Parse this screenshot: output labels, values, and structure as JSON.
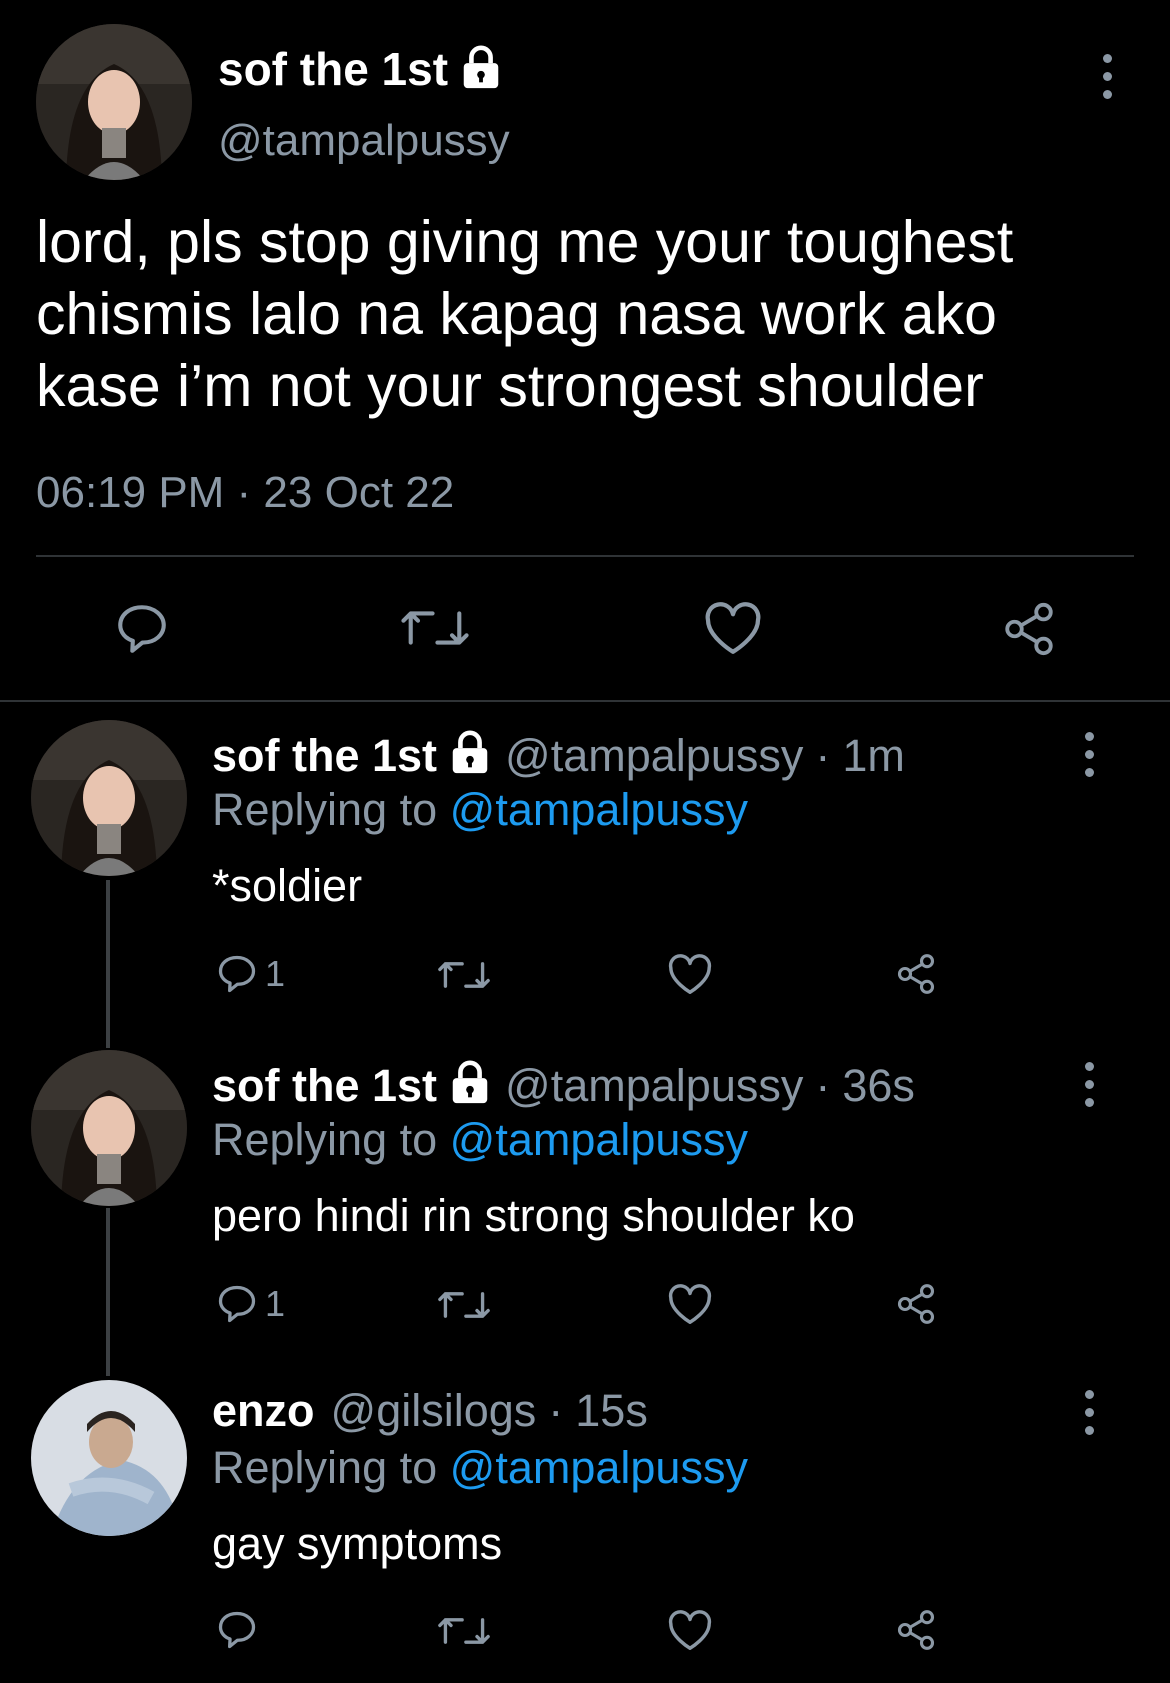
{
  "main_tweet": {
    "display_name": "sof the 1st",
    "handle": "@tampalpussy",
    "text_lines": [
      "lord, pls stop giving me your toughest",
      "chismis lalo na kapag nasa work ako",
      "kase i’m not your strongest shoulder"
    ],
    "timestamp": "06:19 PM · 23 Oct 22",
    "actions": [
      "reply-icon",
      "retweet-icon",
      "like-icon",
      "share-icon"
    ]
  },
  "replies": [
    {
      "display_name": "sof the 1st",
      "handle": "@tampalpussy",
      "sep": "·",
      "time": "1m",
      "replying_label": "Replying to",
      "replying_handle": "@tampalpussy",
      "text": "*soldier",
      "reply_count": "1"
    },
    {
      "display_name": "sof the 1st",
      "handle": "@tampalpussy",
      "sep": "·",
      "time": "36s",
      "replying_label": "Replying to",
      "replying_handle": "@tampalpussy",
      "text": "pero hindi rin strong shoulder ko",
      "reply_count": "1"
    },
    {
      "display_name": "enzo",
      "handle": "@gilsilogs",
      "sep": "·",
      "time": "15s",
      "replying_label": "Replying to",
      "replying_handle": "@tampalpussy",
      "text": "gay symptoms",
      "reply_count": ""
    }
  ],
  "colors": {
    "background": "#000000",
    "muted": "#8b98a5",
    "link": "#1d9bf0",
    "divider": "#2f3336"
  }
}
